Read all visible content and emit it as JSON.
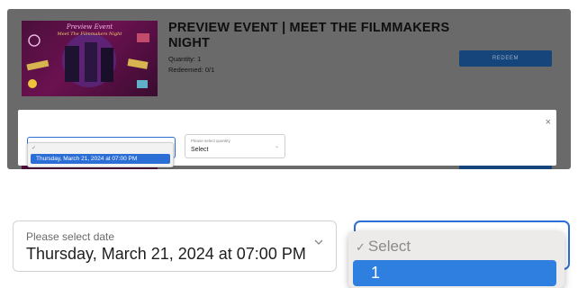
{
  "event": {
    "title": "PREVIEW EVENT | MEET THE FILMMAKERS NIGHT",
    "quantity": "Quantity: 1",
    "redeemed": "Redeemed: 0/1",
    "redeem_label": "REDEEM",
    "poster": {
      "title": "Preview Event",
      "subtitle": "Meet The Filmmakers Night"
    }
  },
  "modal": {
    "close_label": "×",
    "mini_date": {
      "selected_option": "Thursday, March 21, 2024 at 07:00 PM"
    },
    "mini_quantity": {
      "label": "Please select quantity",
      "value": "Select"
    }
  },
  "zoom": {
    "date_select": {
      "label": "Please select date",
      "value": "Thursday, March 21, 2024 at 07:00 PM"
    },
    "quantity_menu": {
      "placeholder": "Select",
      "options": [
        "1"
      ]
    }
  },
  "colors": {
    "accent": "#2b6fd6",
    "redeem_button": "#15457a",
    "overlay": "#6a6a6a"
  }
}
